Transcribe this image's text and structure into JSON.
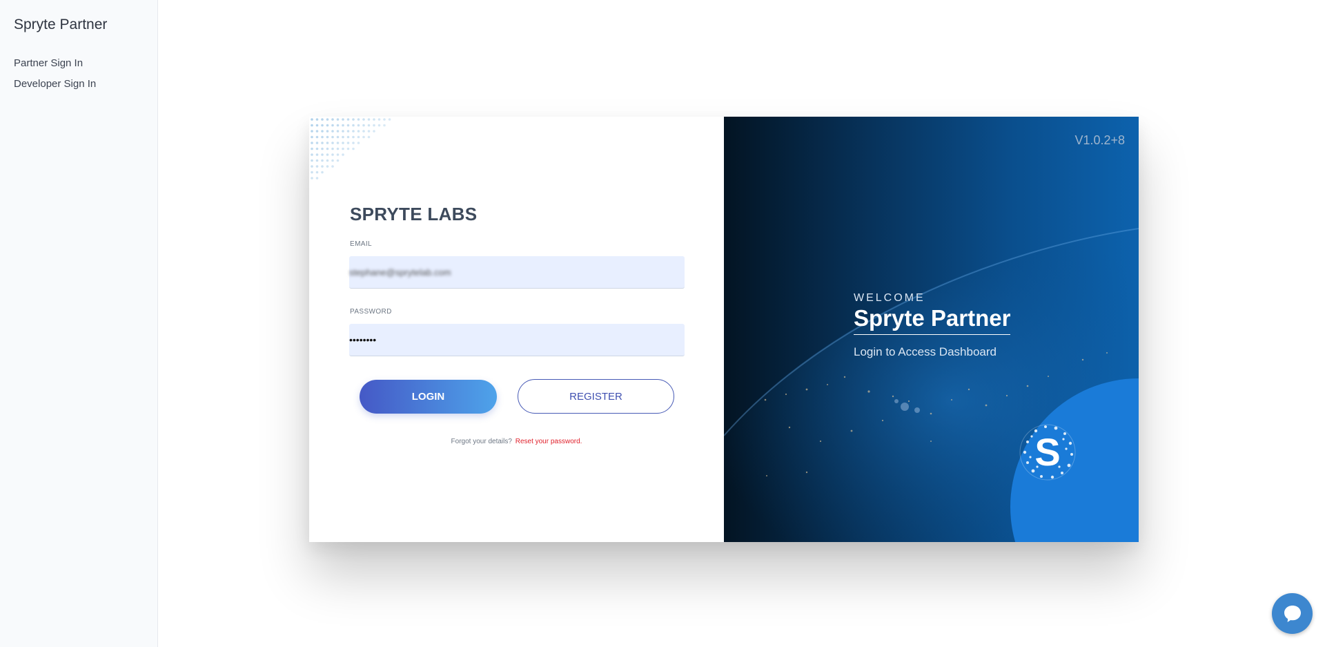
{
  "sidebar": {
    "brand": "Spryte Partner",
    "items": [
      {
        "label": "Partner Sign In"
      },
      {
        "label": "Developer Sign In"
      }
    ]
  },
  "login": {
    "org_title": "SPRYTE LABS",
    "email_label": "EMAIL",
    "email_value": "stephane@sprytelab.com",
    "password_label": "PASSWORD",
    "password_value": "••••••••",
    "login_button": "LOGIN",
    "register_button": "REGISTER",
    "forgot_text": "Forgot your details?",
    "reset_link": "Reset your password."
  },
  "welcome": {
    "version": "V1.0.2+8",
    "small": "WELCOME",
    "title": "Spryte Partner",
    "subtitle": "Login to Access Dashboard"
  },
  "colors": {
    "accent": "#4559c6",
    "gradient_end": "#4ea3ea",
    "reset_link": "#e0202b",
    "panel_dark": "#031423",
    "panel_blue": "#0d62ad",
    "logo_circle": "#1a7bd8",
    "input_bg": "#e8efff"
  },
  "icons": {
    "chat": "chat-bubble-icon",
    "logo": "spryte-s-logo-icon"
  }
}
